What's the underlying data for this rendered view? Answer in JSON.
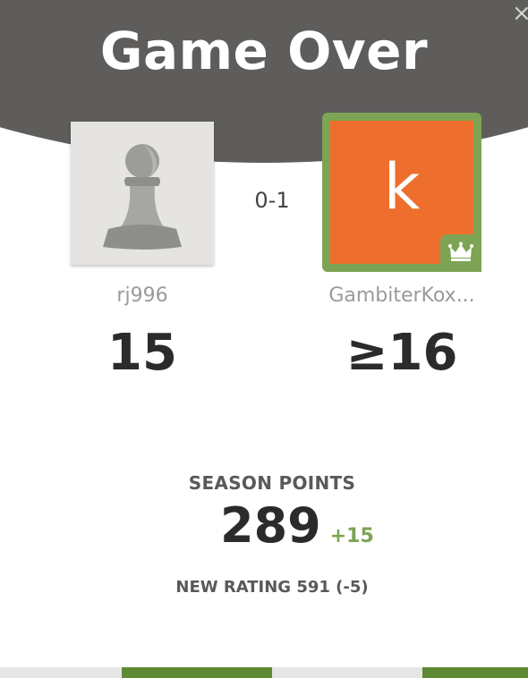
{
  "title": "Game Over",
  "close_icon": "close-icon",
  "close_glyph": "×",
  "result_score": "0-1",
  "players": {
    "left": {
      "username": "rj996",
      "rating": "15",
      "avatar": "pawn-icon"
    },
    "right": {
      "username": "GambiterKox...",
      "rating": "≥16",
      "avatar_letter": "k",
      "avatar_color": "#ee6f2d",
      "badge": "crown-icon"
    }
  },
  "season": {
    "label": "SEASON POINTS",
    "points": "289",
    "delta": "+15"
  },
  "new_rating": "NEW RATING 591 (-5)",
  "colors": {
    "header": "#5e5d5b",
    "accent_green": "#7da454",
    "button_green": "#5e8a33"
  }
}
